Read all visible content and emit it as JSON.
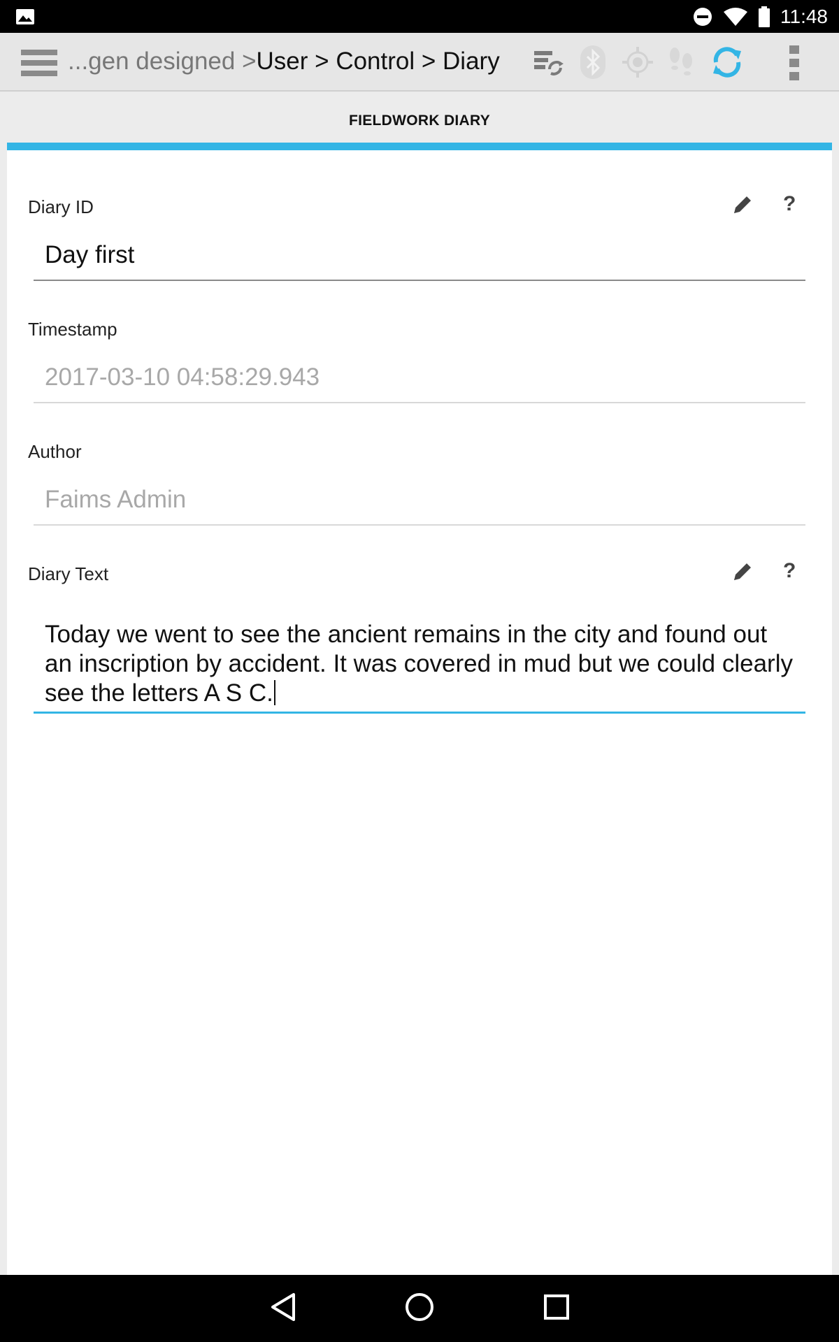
{
  "status_bar": {
    "time": "11:48",
    "icons": [
      "photo-icon",
      "do-not-disturb-icon",
      "wifi-icon",
      "battery-icon"
    ]
  },
  "toolbar": {
    "breadcrumb_prefix": "...gen designed > ",
    "breadcrumb_path": "User > Control > Diary",
    "icons": [
      "menu-icon",
      "sync-status-icon",
      "bluetooth-icon",
      "gps-icon",
      "track-icon",
      "refresh-icon",
      "overflow-menu-icon"
    ],
    "accent": "#33b5e5"
  },
  "tab": {
    "label": "FIELDWORK DIARY"
  },
  "fields": {
    "diary_id": {
      "label": "Diary ID",
      "value": "Day first"
    },
    "timestamp": {
      "label": "Timestamp",
      "value": "2017-03-10 04:58:29.943"
    },
    "author": {
      "label": "Author",
      "value": "Faims Admin"
    },
    "diary_text": {
      "label": "Diary Text",
      "value": "Today we went to see the ancient remains in the city and found out an inscription by accident. It was covered in mud but we could clearly see the letters A S C."
    }
  },
  "nav_bar": {
    "icons": [
      "back-icon",
      "home-icon",
      "recents-icon"
    ]
  }
}
